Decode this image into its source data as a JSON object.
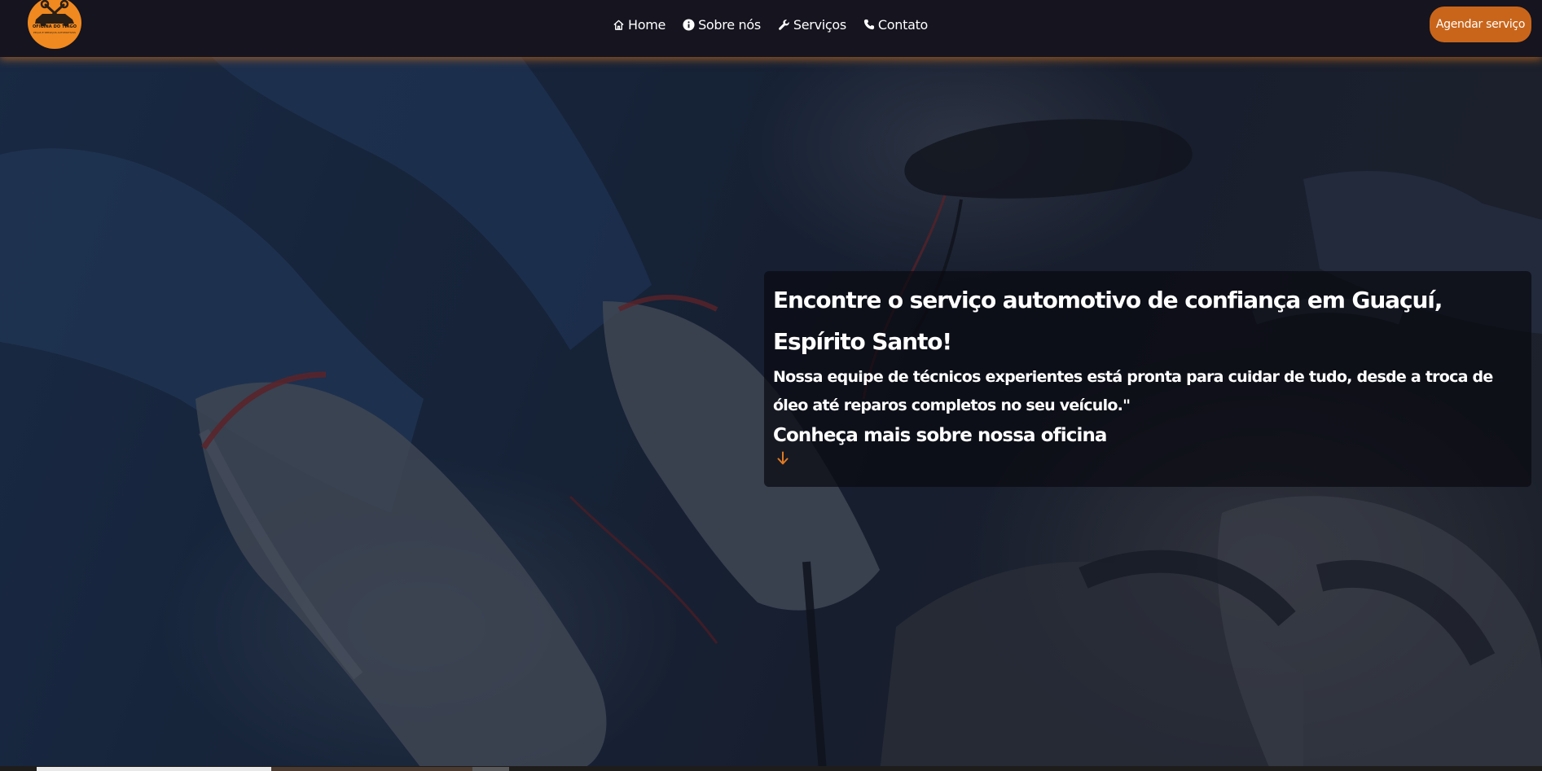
{
  "logo": {
    "name": "OFICINA DO TIAGO",
    "tagline": "PEÇAS E SERVIÇOS AUTOMOTIVOS"
  },
  "nav": {
    "items": [
      {
        "label": "Home",
        "icon": "home-icon"
      },
      {
        "label": "Sobre nós",
        "icon": "info-icon"
      },
      {
        "label": "Serviços",
        "icon": "wrench-icon"
      },
      {
        "label": "Contato",
        "icon": "phone-icon"
      }
    ],
    "cta_label": "Agendar serviço"
  },
  "hero": {
    "title": "Encontre o serviço automotivo de confiança em Guaçuí, Espírito Santo!",
    "description": "Nossa equipe de técnicos experientes está pronta para cuidar de tudo, desde a troca de óleo até reparos completos no seu veículo.\"",
    "link_label": "Conheça mais sobre nossa oficina",
    "link_icon": "arrow-down-icon"
  },
  "colors": {
    "header_bg": "#15141f",
    "accent": "#c9651a",
    "logo_bg": "#f0891f",
    "arrow": "#e07a22"
  }
}
